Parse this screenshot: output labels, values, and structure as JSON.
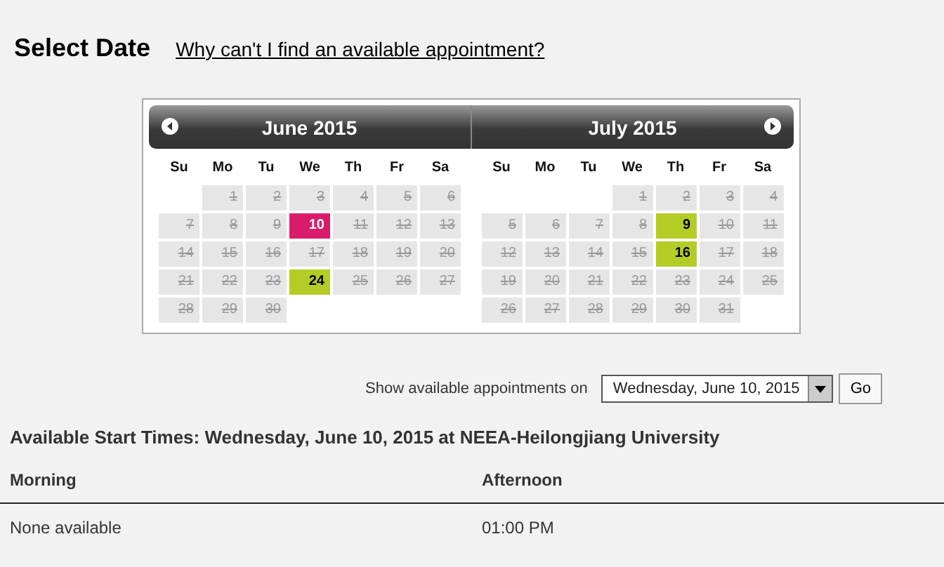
{
  "title": "Select Date",
  "help_link": "Why can't I find an available appointment?",
  "calendar": {
    "months": [
      {
        "title": "June 2015",
        "prev_arrow": true,
        "next_arrow": false,
        "weekdays": [
          "Su",
          "Mo",
          "Tu",
          "We",
          "Th",
          "Fr",
          "Sa"
        ],
        "weeks": [
          [
            {
              "kind": "blank"
            },
            {
              "day": "1",
              "kind": "unavailable",
              "selected": false
            },
            {
              "day": "2",
              "kind": "unavailable",
              "selected": false
            },
            {
              "day": "3",
              "kind": "unavailable",
              "selected": false
            },
            {
              "day": "4",
              "kind": "unavailable",
              "selected": false
            },
            {
              "day": "5",
              "kind": "unavailable",
              "selected": false
            },
            {
              "day": "6",
              "kind": "unavailable",
              "selected": false
            }
          ],
          [
            {
              "day": "7",
              "kind": "unavailable",
              "selected": false
            },
            {
              "day": "8",
              "kind": "unavailable",
              "selected": false
            },
            {
              "day": "9",
              "kind": "unavailable",
              "selected": false
            },
            {
              "day": "10",
              "kind": "available",
              "selected": true
            },
            {
              "day": "11",
              "kind": "unavailable",
              "selected": false
            },
            {
              "day": "12",
              "kind": "unavailable",
              "selected": false
            },
            {
              "day": "13",
              "kind": "unavailable",
              "selected": false
            }
          ],
          [
            {
              "day": "14",
              "kind": "unavailable",
              "selected": false
            },
            {
              "day": "15",
              "kind": "unavailable",
              "selected": false
            },
            {
              "day": "16",
              "kind": "unavailable",
              "selected": false
            },
            {
              "day": "17",
              "kind": "unavailable",
              "selected": false
            },
            {
              "day": "18",
              "kind": "unavailable",
              "selected": false
            },
            {
              "day": "19",
              "kind": "unavailable",
              "selected": false
            },
            {
              "day": "20",
              "kind": "unavailable",
              "selected": false
            }
          ],
          [
            {
              "day": "21",
              "kind": "unavailable",
              "selected": false
            },
            {
              "day": "22",
              "kind": "unavailable",
              "selected": false
            },
            {
              "day": "23",
              "kind": "unavailable",
              "selected": false
            },
            {
              "day": "24",
              "kind": "available",
              "selected": false
            },
            {
              "day": "25",
              "kind": "unavailable",
              "selected": false
            },
            {
              "day": "26",
              "kind": "unavailable",
              "selected": false
            },
            {
              "day": "27",
              "kind": "unavailable",
              "selected": false
            }
          ],
          [
            {
              "day": "28",
              "kind": "unavailable",
              "selected": false
            },
            {
              "day": "29",
              "kind": "unavailable",
              "selected": false
            },
            {
              "day": "30",
              "kind": "unavailable",
              "selected": false
            }
          ]
        ]
      },
      {
        "title": "July 2015",
        "prev_arrow": false,
        "next_arrow": true,
        "weekdays": [
          "Su",
          "Mo",
          "Tu",
          "We",
          "Th",
          "Fr",
          "Sa"
        ],
        "weeks": [
          [
            {
              "kind": "blank"
            },
            {
              "kind": "blank"
            },
            {
              "kind": "blank"
            },
            {
              "day": "1",
              "kind": "unavailable",
              "selected": false
            },
            {
              "day": "2",
              "kind": "unavailable",
              "selected": false
            },
            {
              "day": "3",
              "kind": "unavailable",
              "selected": false
            },
            {
              "day": "4",
              "kind": "unavailable",
              "selected": false
            }
          ],
          [
            {
              "day": "5",
              "kind": "unavailable",
              "selected": false
            },
            {
              "day": "6",
              "kind": "unavailable",
              "selected": false
            },
            {
              "day": "7",
              "kind": "unavailable",
              "selected": false
            },
            {
              "day": "8",
              "kind": "unavailable",
              "selected": false
            },
            {
              "day": "9",
              "kind": "available",
              "selected": false
            },
            {
              "day": "10",
              "kind": "unavailable",
              "selected": false
            },
            {
              "day": "11",
              "kind": "unavailable",
              "selected": false
            }
          ],
          [
            {
              "day": "12",
              "kind": "unavailable",
              "selected": false
            },
            {
              "day": "13",
              "kind": "unavailable",
              "selected": false
            },
            {
              "day": "14",
              "kind": "unavailable",
              "selected": false
            },
            {
              "day": "15",
              "kind": "unavailable",
              "selected": false
            },
            {
              "day": "16",
              "kind": "available",
              "selected": false
            },
            {
              "day": "17",
              "kind": "unavailable",
              "selected": false
            },
            {
              "day": "18",
              "kind": "unavailable",
              "selected": false
            }
          ],
          [
            {
              "day": "19",
              "kind": "unavailable",
              "selected": false
            },
            {
              "day": "20",
              "kind": "unavailable",
              "selected": false
            },
            {
              "day": "21",
              "kind": "unavailable",
              "selected": false
            },
            {
              "day": "22",
              "kind": "unavailable",
              "selected": false
            },
            {
              "day": "23",
              "kind": "unavailable",
              "selected": false
            },
            {
              "day": "24",
              "kind": "unavailable",
              "selected": false
            },
            {
              "day": "25",
              "kind": "unavailable",
              "selected": false
            }
          ],
          [
            {
              "day": "26",
              "kind": "unavailable",
              "selected": false
            },
            {
              "day": "27",
              "kind": "unavailable",
              "selected": false
            },
            {
              "day": "28",
              "kind": "unavailable",
              "selected": false
            },
            {
              "day": "29",
              "kind": "unavailable",
              "selected": false
            },
            {
              "day": "30",
              "kind": "unavailable",
              "selected": false
            },
            {
              "day": "31",
              "kind": "unavailable",
              "selected": false
            }
          ]
        ]
      }
    ]
  },
  "show_on": {
    "label": "Show available appointments on",
    "value": "Wednesday, June 10, 2015",
    "button": "Go"
  },
  "results": {
    "heading": "Available Start Times: Wednesday, June 10, 2015 at NEEA-Heilongjiang University",
    "columns": [
      "Morning",
      "Afternoon"
    ],
    "rows": [
      [
        "None available",
        "01:00 PM"
      ]
    ]
  }
}
